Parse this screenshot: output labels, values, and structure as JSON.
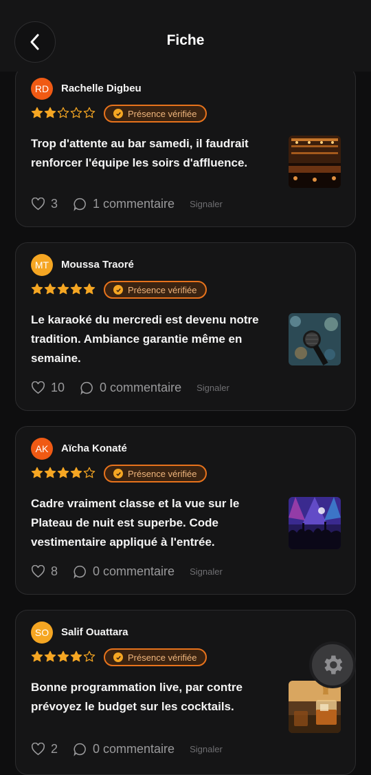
{
  "header": {
    "title": "Fiche"
  },
  "reviews": [
    {
      "initials": "RD",
      "author": "Rachelle Digbeu",
      "rating": 2,
      "badge": "Présence vérifiée",
      "text": "Trop d'attente au bar samedi, il faudrait renforcer l'équipe les soirs d'affluence.",
      "likes": "3",
      "comments": "1 commentaire",
      "report": "Signaler",
      "avatar_color": "#f05a14",
      "thumb": "bar-counter-photo"
    },
    {
      "initials": "MT",
      "author": "Moussa Traoré",
      "rating": 5,
      "badge": "Présence vérifiée",
      "text": "Le karaoké du mercredi est devenu notre tradition. Ambiance garantie même en semaine.",
      "likes": "10",
      "comments": "0 commentaire",
      "report": "Signaler",
      "avatar_color": "#f5a623",
      "thumb": "microphone-photo"
    },
    {
      "initials": "AK",
      "author": "Aïcha Konaté",
      "rating": 4,
      "badge": "Présence vérifiée",
      "text": "Cadre vraiment classe et la vue sur le Plateau de nuit est superbe. Code vestimentaire appliqué à l'entrée.",
      "likes": "8",
      "comments": "0 commentaire",
      "report": "Signaler",
      "avatar_color": "#f05a14",
      "thumb": "concert-crowd-photo"
    },
    {
      "initials": "SO",
      "author": "Salif Ouattara",
      "rating": 4,
      "badge": "Présence vérifiée",
      "text": "Bonne programmation live, par contre prévoyez le budget sur les cocktails.",
      "likes": "2",
      "comments": "0 commentaire",
      "report": "Signaler",
      "avatar_color": "#f5a623",
      "thumb": "whisky-glass-photo"
    }
  ],
  "colors": {
    "star": "#f5a623",
    "badge_border": "#e8731c",
    "card_bg": "#151516"
  }
}
